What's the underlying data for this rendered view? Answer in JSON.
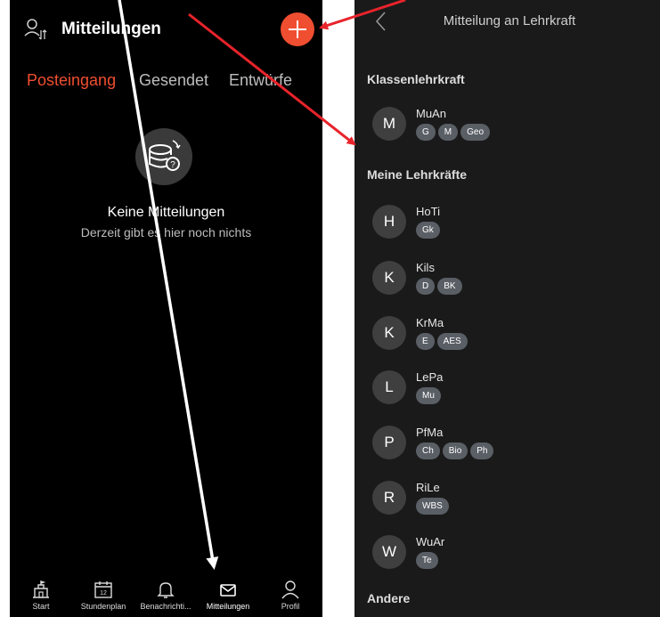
{
  "left": {
    "title": "Mitteilungen",
    "tabs": [
      {
        "label": "Posteingang",
        "active": true
      },
      {
        "label": "Gesendet",
        "active": false
      },
      {
        "label": "Entwürfe",
        "active": false
      }
    ],
    "empty": {
      "title": "Keine Mitteilungen",
      "subtitle": "Derzeit gibt es hier noch nichts"
    },
    "nav": [
      {
        "label": "Start",
        "icon": "school-icon"
      },
      {
        "label": "Stundenplan",
        "icon": "calendar-icon",
        "badge": "12"
      },
      {
        "label": "Benachrichti...",
        "icon": "bell-icon"
      },
      {
        "label": "Mitteilungen",
        "icon": "mail-icon",
        "active": true
      },
      {
        "label": "Profil",
        "icon": "person-icon"
      }
    ]
  },
  "right": {
    "title": "Mitteilung an Lehrkraft",
    "sections": {
      "class_teacher": "Klassenlehrkraft",
      "my_teachers": "Meine Lehrkräfte",
      "other": "Andere"
    },
    "class_teacher": {
      "initial": "M",
      "name": "MuAn",
      "subjects": [
        "G",
        "M",
        "Geo"
      ]
    },
    "teachers": [
      {
        "initial": "H",
        "name": "HoTi",
        "subjects": [
          "Gk"
        ]
      },
      {
        "initial": "K",
        "name": "Kils",
        "subjects": [
          "D",
          "BK"
        ]
      },
      {
        "initial": "K",
        "name": "KrMa",
        "subjects": [
          "E",
          "AES"
        ]
      },
      {
        "initial": "L",
        "name": "LePa",
        "subjects": [
          "Mu"
        ]
      },
      {
        "initial": "P",
        "name": "PfMa",
        "subjects": [
          "Ch",
          "Bio",
          "Ph"
        ]
      },
      {
        "initial": "R",
        "name": "RiLe",
        "subjects": [
          "WBS"
        ]
      },
      {
        "initial": "W",
        "name": "WuAr",
        "subjects": [
          "Te"
        ]
      }
    ]
  },
  "colors": {
    "accent": "#f04e30",
    "annotation_red": "#e8232b",
    "annotation_white": "#ffffff"
  }
}
